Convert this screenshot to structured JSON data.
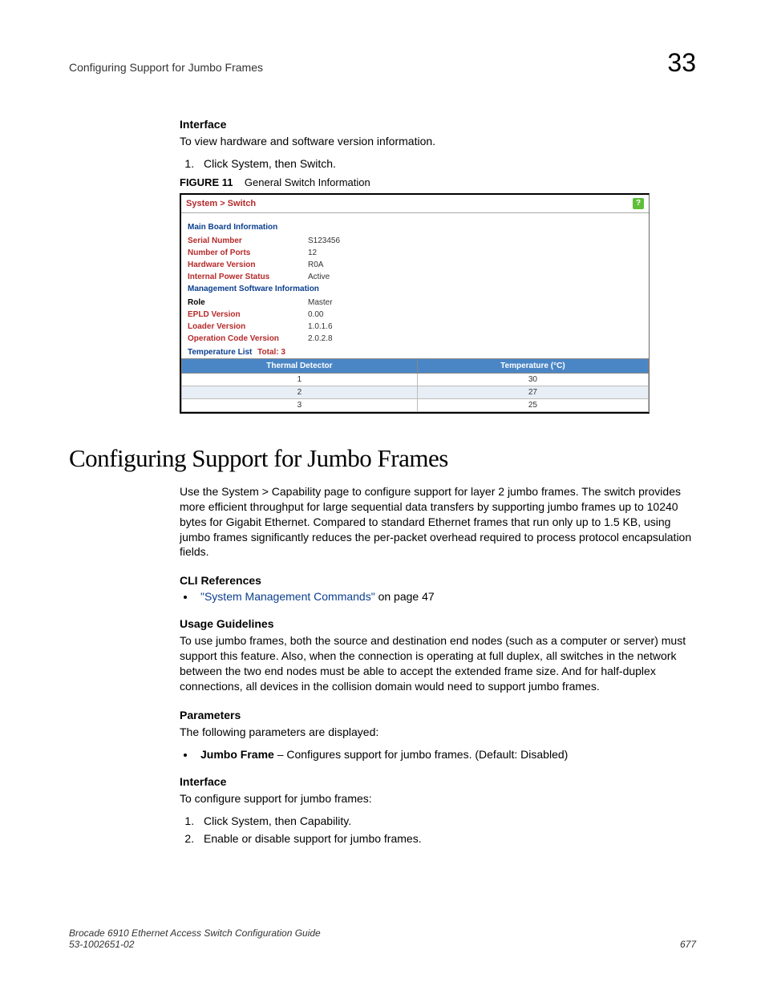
{
  "header": {
    "running_title": "Configuring Support for Jumbo Frames",
    "chapter_number": "33"
  },
  "section1": {
    "interface_heading": "Interface",
    "interface_text": "To view hardware and software version information.",
    "step1": "Click System, then Switch.",
    "figure_label_prefix": "FIGURE 11",
    "figure_label_caption": "General Switch Information"
  },
  "figure": {
    "breadcrumb": "System > Switch",
    "help_glyph": "?",
    "main_board_title": "Main Board Information",
    "rows_main": [
      {
        "label": "Serial Number",
        "value": "S123456"
      },
      {
        "label": "Number of Ports",
        "value": "12"
      },
      {
        "label": "Hardware Version",
        "value": "R0A"
      },
      {
        "label": "Internal Power Status",
        "value": "Active"
      }
    ],
    "mgmt_title": "Management Software Information",
    "rows_mgmt": [
      {
        "label": "Role",
        "value": "Master",
        "black": true
      },
      {
        "label": "EPLD Version",
        "value": "0.00"
      },
      {
        "label": "Loader Version",
        "value": "1.0.1.6"
      },
      {
        "label": "Operation Code Version",
        "value": "2.0.2.8"
      }
    ],
    "temp_list_label": "Temperature List",
    "temp_total": "Total: 3",
    "temp_headers": [
      "Thermal Detector",
      "Temperature (°C)"
    ],
    "temp_rows": [
      [
        "1",
        "30"
      ],
      [
        "2",
        "27"
      ],
      [
        "3",
        "25"
      ]
    ]
  },
  "section2": {
    "heading": "Configuring Support for Jumbo Frames",
    "intro": "Use the System > Capability page to configure support for layer 2 jumbo frames. The switch provides more efficient throughput for large sequential data transfers by supporting jumbo frames up to 10240 bytes for Gigabit Ethernet. Compared to standard Ethernet frames that run only up to 1.5 KB, using jumbo frames significantly reduces the per-packet overhead required to process protocol encapsulation fields.",
    "cli_heading": "CLI References",
    "cli_link_text": "\"System Management Commands\"",
    "cli_link_suffix": " on page 47",
    "usage_heading": "Usage Guidelines",
    "usage_text": "To use jumbo frames, both the source and destination end nodes (such as a computer or server) must support this feature. Also, when the connection is operating at full duplex, all switches in the network between the two end nodes must be able to accept the extended frame size. And for half-duplex connections, all devices in the collision domain would need to support jumbo frames.",
    "params_heading": "Parameters",
    "params_intro": "The following parameters are displayed:",
    "param_name": "Jumbo Frame",
    "param_desc": " – Configures support for jumbo frames. (Default: Disabled)",
    "interface_heading": "Interface",
    "interface_text": "To configure support for jumbo frames:",
    "steps": [
      "Click System, then Capability.",
      "Enable or disable support for jumbo frames."
    ]
  },
  "footer": {
    "guide_title": "Brocade 6910 Ethernet Access Switch Configuration Guide",
    "doc_number": "53-1002651-02",
    "page_number": "677"
  }
}
